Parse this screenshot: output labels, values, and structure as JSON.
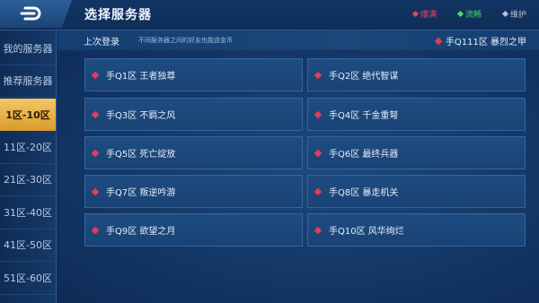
{
  "header": {
    "title": "选择服务器",
    "legend": [
      {
        "label": "爆满",
        "color": "#e8445a"
      },
      {
        "label": "流畅",
        "color": "#4fd86c"
      },
      {
        "label": "维护",
        "color": "#b8c4d4"
      }
    ]
  },
  "sidebar": {
    "items": [
      {
        "label": "我的服务器",
        "active": false
      },
      {
        "label": "推荐服务器",
        "active": false
      },
      {
        "label": "1区-10区",
        "active": true
      },
      {
        "label": "11区-20区",
        "active": false
      },
      {
        "label": "21区-30区",
        "active": false
      },
      {
        "label": "31区-40区",
        "active": false
      },
      {
        "label": "41区-50区",
        "active": false
      },
      {
        "label": "51区-60区",
        "active": false
      }
    ]
  },
  "last_login": {
    "label": "上次登录",
    "note": "不同服务器之间的好友也能送金币",
    "server": "手Q111区 暴烈之甲"
  },
  "servers": [
    "手Q1区 王者独尊",
    "手Q2区 绝代智谋",
    "手Q3区 不羁之风",
    "手Q4区 千金重弩",
    "手Q5区 死亡绽放",
    "手Q6区 最终兵器",
    "手Q7区 叛逆吟游",
    "手Q8区 暴走机关",
    "手Q9区 欲望之月",
    "手Q10区 风华绚烂"
  ],
  "colors": {
    "status_full": "#e63c55",
    "active_tab": "#f4c766"
  }
}
